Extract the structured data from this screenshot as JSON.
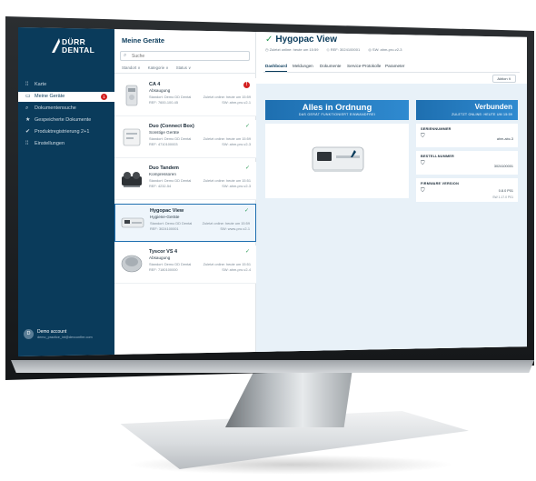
{
  "sidebar": {
    "logo_line1": "DÜRR",
    "logo_line2": "DENTAL",
    "items": [
      {
        "label": "Karte",
        "icon": "map-icon",
        "glyph": "⁞⁞",
        "active": false
      },
      {
        "label": "Meine Geräte",
        "icon": "devices-icon",
        "glyph": "▭",
        "active": true,
        "badge": "1"
      },
      {
        "label": "Dokumentensuche",
        "icon": "search-icon",
        "glyph": "⌕",
        "active": false
      },
      {
        "label": "Gespeicherte Dokumente",
        "icon": "star-icon",
        "glyph": "★",
        "active": false
      },
      {
        "label": "Produktregistrierung 2+1",
        "icon": "check-circle-icon",
        "glyph": "✔",
        "active": false
      },
      {
        "label": "Einstellungen",
        "icon": "settings-icon",
        "glyph": "⁞⁞",
        "active": false
      }
    ],
    "user": {
      "initial": "D",
      "name": "Demo account",
      "email": "demo_practice_int@dexconfire.com"
    }
  },
  "list": {
    "title": "Meine Geräte",
    "search_placeholder": "Suche",
    "filters": [
      "Standort ∨",
      "Kategorie ∨",
      "Status ∨"
    ],
    "devices": [
      {
        "name": "CA 4",
        "type": "Absaugung",
        "location": "Standort: Demo DD Dental",
        "ref": "REF: 7600-100-45",
        "seen": "Zuletzt online: heute um 15:59",
        "sw": "SW: ahm-pro-v2-1",
        "status": "alert",
        "status_glyph": "!",
        "selected": false
      },
      {
        "name": "Duo (Connect Box)",
        "type": "Sonstige Geräte",
        "location": "Standort: Demo DD Dental",
        "ref": "REF: 4710100003",
        "seen": "Zuletzt online: heute um 15:59",
        "sw": "SW: ahm-pro-v2-3",
        "status": "ok",
        "status_glyph": "✓",
        "selected": false
      },
      {
        "name": "Duo Tandem",
        "type": "Kompressoren",
        "location": "Standort: Demo DD Dental",
        "ref": "REF: 4232-54",
        "seen": "Zuletzt online: heute um 15:51",
        "sw": "SW: ahm-pro-v2-3",
        "status": "ok",
        "status_glyph": "✓",
        "selected": false
      },
      {
        "name": "Hygopac View",
        "type": "Hygiene-Geräte",
        "location": "Standort: Demo DD Dental",
        "ref": "REF: 3024100001",
        "seen": "Zuletzt online: heute um 15:59",
        "sw": "SW: www-pro-v2-1",
        "status": "ok",
        "status_glyph": "✓",
        "selected": true
      },
      {
        "name": "Tyscor VS 4",
        "type": "Absaugung",
        "location": "Standort: Demo DD Dental",
        "ref": "REF: 7180100000",
        "seen": "Zuletzt online: heute um 15:51",
        "sw": "SW: ahm-pro-v2-4",
        "status": "ok",
        "status_glyph": "✓",
        "selected": false
      }
    ]
  },
  "detail": {
    "title": "Hygopac View",
    "title_check": "✓",
    "meta": [
      "◷ Zuletzt online: heute um 15:59",
      "◇ REF: 3024100001",
      "◎ SW: ahm-pro-v2-3"
    ],
    "tabs": [
      "Dashboard",
      "Meldungen",
      "Dokumente",
      "Service-Protokolle",
      "Parameter"
    ],
    "action_label": "Aktion ∨",
    "status_card": {
      "big": "Alles in Ordnung",
      "small": "DAS GERÄT FUNKTIONIERT EINWANDFREI"
    },
    "connection_card": {
      "big": "Verbunden",
      "small": "ZULETZT ONLINE: HEUTE UM 15:59"
    },
    "info_cards": [
      {
        "label": "SERIENNUMMER",
        "value": "ahm-abc-3",
        "value2": ""
      },
      {
        "label": "BESTELLNUMMER",
        "value": "3024100001",
        "value2": ""
      },
      {
        "label": "FIRMWARE VERSION",
        "value": "0.8.0 P01",
        "value2": "SW 1.17.0 P01"
      }
    ]
  }
}
